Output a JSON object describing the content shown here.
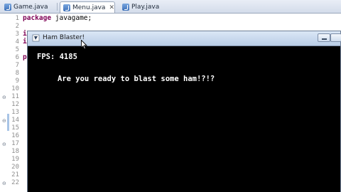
{
  "editor": {
    "tabs": [
      {
        "label": "Game.java"
      },
      {
        "label": "Menu.java",
        "active": true
      },
      {
        "label": "Play.java"
      }
    ],
    "line_numbers": [
      "1",
      "2",
      "3",
      "4",
      "5",
      "6",
      "7",
      "8",
      "9",
      "10",
      "11",
      "12",
      "13",
      "14",
      "15",
      "16",
      "17",
      "18",
      "19",
      "20",
      "21",
      "22"
    ],
    "line1_keyword": "package",
    "line1_rest": " javagame;",
    "line4_fragment": "i",
    "line5_fragment": "i",
    "line7_fragment": "p"
  },
  "window": {
    "title": "Ham Blaster!",
    "fps_text": "FPS: 4185",
    "message": "Are you ready to blast some ham!?!?"
  },
  "icons": [
    "java-file-icon",
    "close-icon",
    "fold-marker-icon",
    "app-icon",
    "minimize-icon",
    "cursor-icon"
  ]
}
